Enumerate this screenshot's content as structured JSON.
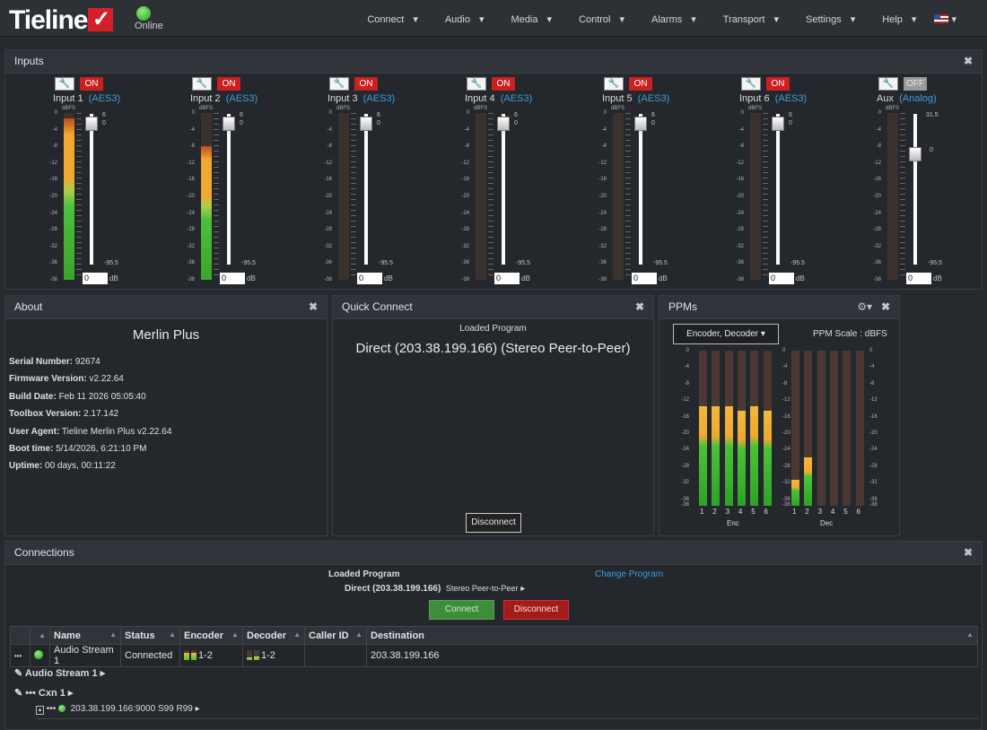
{
  "nav": {
    "logo": "Tieline",
    "status": "Online",
    "menu": [
      "Connect",
      "Audio",
      "Media",
      "Control",
      "Alarms",
      "Transport",
      "Settings",
      "Help"
    ]
  },
  "inputs_panel": {
    "title": "Inputs",
    "channels": [
      {
        "name": "Input 1",
        "source": "(AES3)",
        "state": "ON",
        "fader_top": "6",
        "fader_mid": "0",
        "fader_bottom": "-95.5",
        "gain": "0",
        "level": 0.97
      },
      {
        "name": "Input 2",
        "source": "(AES3)",
        "state": "ON",
        "fader_top": "6",
        "fader_mid": "0",
        "fader_bottom": "-95.5",
        "gain": "0",
        "level": 0.8
      },
      {
        "name": "Input 3",
        "source": "(AES3)",
        "state": "ON",
        "fader_top": "6",
        "fader_mid": "0",
        "fader_bottom": "-95.5",
        "gain": "0",
        "level": 0
      },
      {
        "name": "Input 4",
        "source": "(AES3)",
        "state": "ON",
        "fader_top": "6",
        "fader_mid": "0",
        "fader_bottom": "-95.5",
        "gain": "0",
        "level": 0
      },
      {
        "name": "Input 5",
        "source": "(AES3)",
        "state": "ON",
        "fader_top": "6",
        "fader_mid": "0",
        "fader_bottom": "-95.5",
        "gain": "0",
        "level": 0
      },
      {
        "name": "Input 6",
        "source": "(AES3)",
        "state": "ON",
        "fader_top": "6",
        "fader_mid": "0",
        "fader_bottom": "-95.5",
        "gain": "0",
        "level": 0
      },
      {
        "name": "Aux",
        "source": "(Analog)",
        "state": "OFF",
        "fader_top": "31.5",
        "fader_mid": "0",
        "fader_bottom": "-95.5",
        "gain": "0",
        "level": 0
      }
    ],
    "scale_labels": [
      "0",
      "-4",
      "-8",
      "-12",
      "-16",
      "-20",
      "-24",
      "-28",
      "-32",
      "-36",
      "-38"
    ],
    "scale_unit": "dBFS",
    "gain_unit": "dB"
  },
  "about": {
    "title": "About",
    "product": "Merlin Plus",
    "rows": [
      {
        "k": "Serial Number:",
        "v": "92674"
      },
      {
        "k": "Firmware Version:",
        "v": "v2.22.64"
      },
      {
        "k": "Build Date:",
        "v": "Feb 11 2026 05:05:40"
      },
      {
        "k": "Toolbox Version:",
        "v": "2.17.142"
      },
      {
        "k": "User Agent:",
        "v": "Tieline Merlin Plus v2.22.64"
      },
      {
        "k": "Boot time:",
        "v": "5/14/2026, 6:21:10 PM"
      },
      {
        "k": "Uptime:",
        "v": "00 days, 00:11:22"
      }
    ]
  },
  "quick_connect": {
    "title": "Quick Connect",
    "loaded_label": "Loaded Program",
    "program": "Direct (203.38.199.166) (Stereo Peer-to-Peer)",
    "disconnect": "Disconnect"
  },
  "ppms": {
    "title": "PPMs",
    "dropdown": "Encoder, Decoder",
    "scale_label": "PPM Scale : dBFS",
    "enc_label": "Enc",
    "dec_label": "Dec",
    "enc_levels": [
      0.64,
      0.64,
      0.64,
      0.61,
      0.64,
      0.61
    ],
    "dec_levels": [
      0.17,
      0.31,
      0,
      0,
      0,
      0
    ],
    "channel_numbers": [
      "1",
      "2",
      "3",
      "4",
      "5",
      "6"
    ]
  },
  "connections": {
    "title": "Connections",
    "loaded_label": "Loaded Program",
    "change_program": "Change Program",
    "program_name": "Direct (203.38.199.166)",
    "program_type": "Stereo Peer-to-Peer",
    "connect": "Connect",
    "disconnect": "Disconnect",
    "columns": [
      "Name",
      "Status",
      "Encoder",
      "Decoder",
      "Caller ID",
      "Destination"
    ],
    "row": {
      "more": "•••",
      "name": "Audio Stream 1",
      "status": "Connected",
      "encoder": "1-2",
      "decoder": "1-2",
      "caller_id": "",
      "destination": "203.38.199.166"
    },
    "tree_stream": "Audio Stream 1",
    "tree_cxn": "Cxn 1",
    "tree_endpoint": "203.38.199.166:9000 S99 R99"
  }
}
